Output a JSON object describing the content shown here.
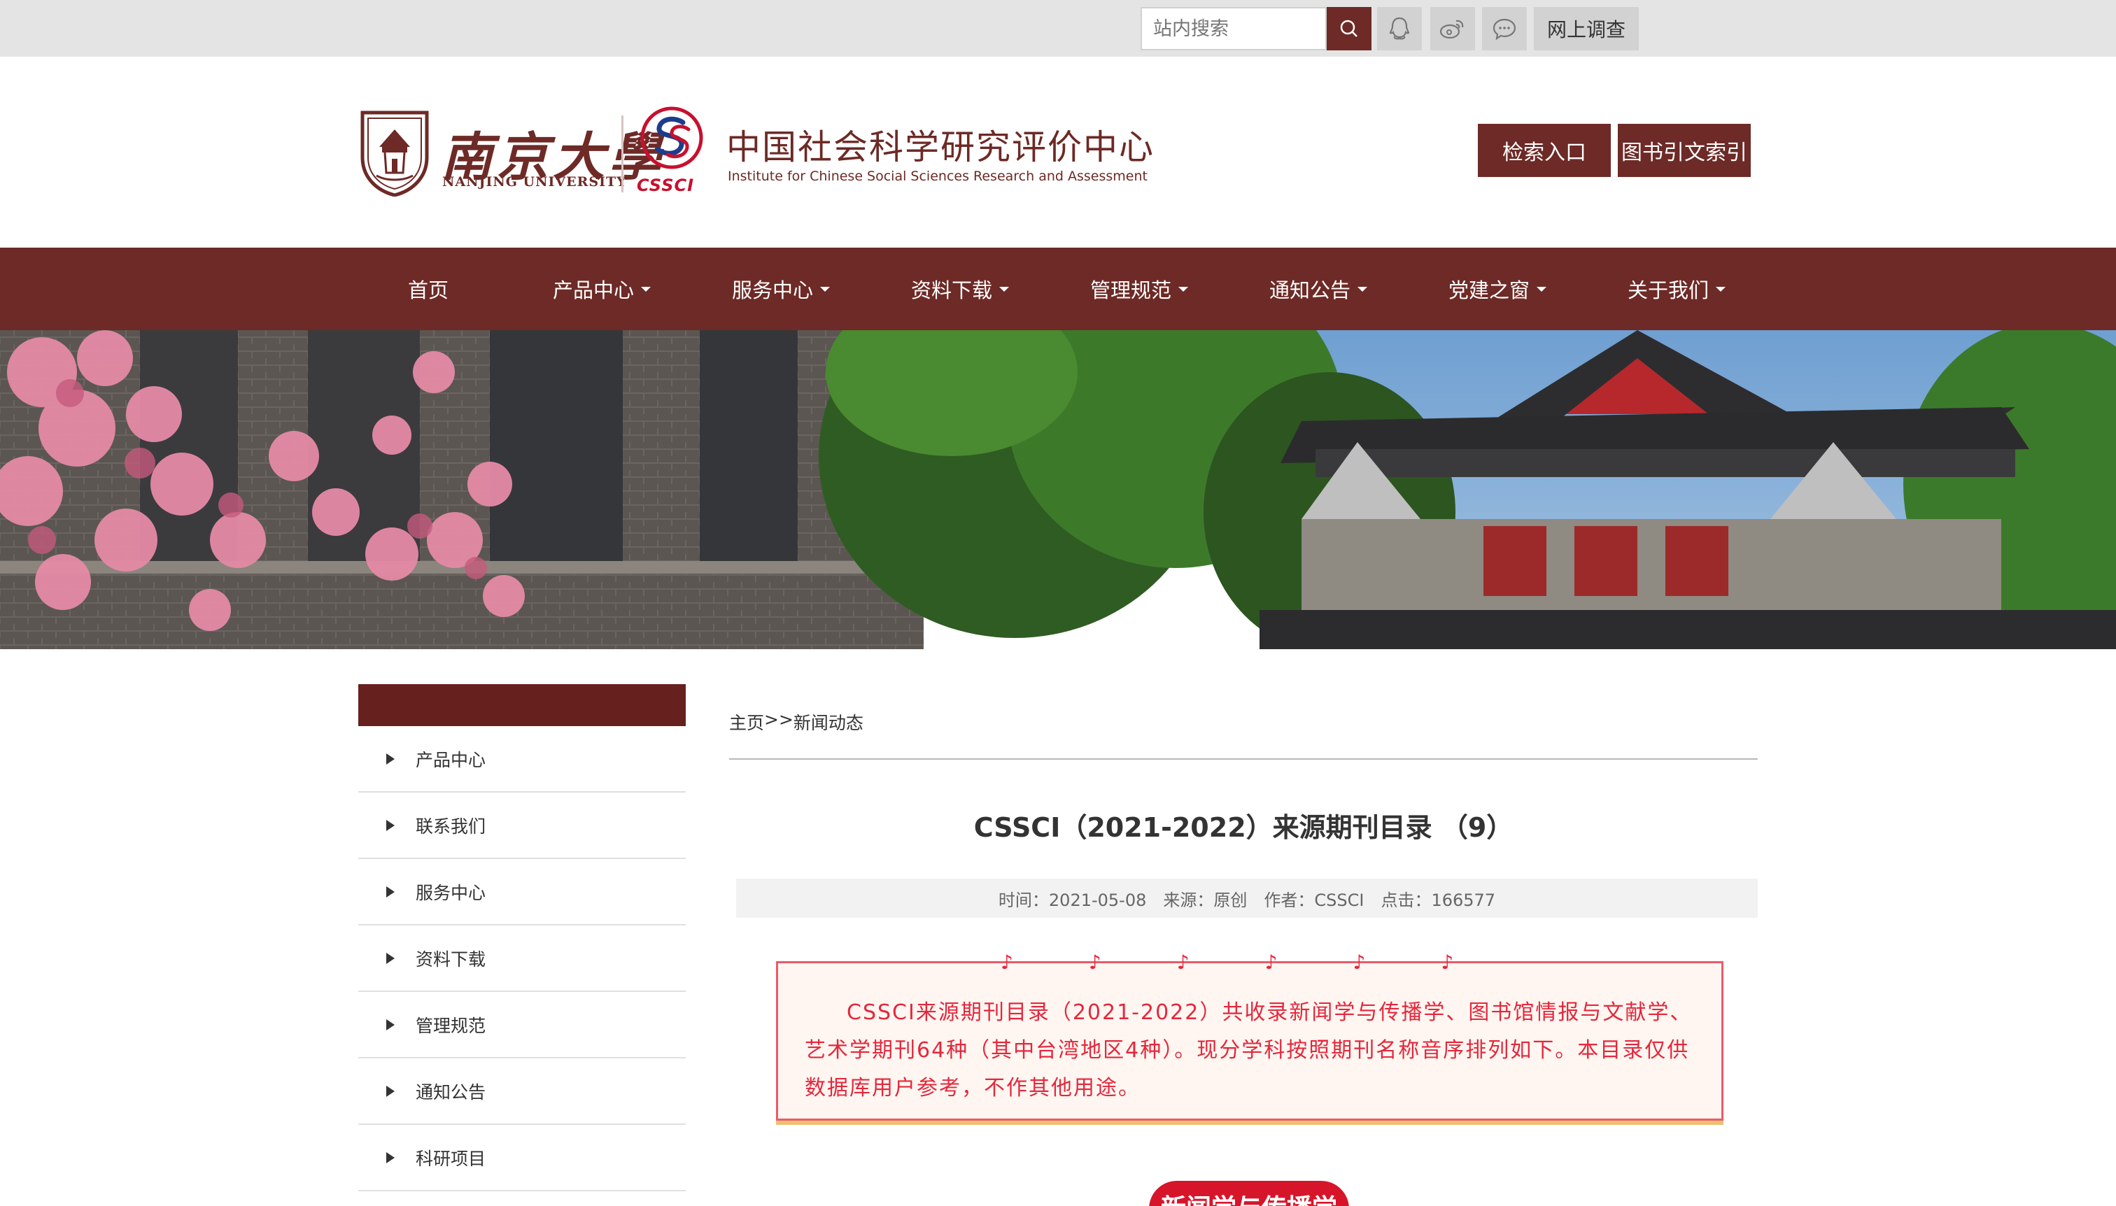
{
  "topbar": {
    "search_placeholder": "站内搜索",
    "search_icon": "search-icon",
    "social_icons": [
      "qq-icon",
      "weibo-icon",
      "wechat-icon"
    ],
    "survey_label": "网上调查"
  },
  "header": {
    "university_name_cn": "南京大學",
    "university_name_en": "NANJING UNIVERSITY",
    "cssci_logo_text": "CSSCI",
    "center_name_cn": "中国社会科学研究评价中心",
    "center_name_en": "Institute for Chinese Social Sciences Research and Assessment",
    "buttons": [
      "检索入口",
      "图书引文索引"
    ]
  },
  "nav": {
    "items": [
      {
        "label": "首页",
        "has_dropdown": false
      },
      {
        "label": "产品中心",
        "has_dropdown": true
      },
      {
        "label": "服务中心",
        "has_dropdown": true
      },
      {
        "label": "资料下载",
        "has_dropdown": true
      },
      {
        "label": "管理规范",
        "has_dropdown": true
      },
      {
        "label": "通知公告",
        "has_dropdown": true
      },
      {
        "label": "党建之窗",
        "has_dropdown": true
      },
      {
        "label": "关于我们",
        "has_dropdown": true
      }
    ]
  },
  "sidebar": {
    "items": [
      "产品中心",
      "联系我们",
      "服务中心",
      "资料下载",
      "管理规范",
      "通知公告",
      "科研项目"
    ]
  },
  "breadcrumb": {
    "home": "主页",
    "separator": " >>",
    "current": "新闻动态"
  },
  "article": {
    "title": "CSSCI（2021-2022）来源期刊目录 （9）",
    "meta": {
      "time": "时间：2021-05-08",
      "source": "来源：原创",
      "author": "作者：CSSCI",
      "clicks": "点击：166577"
    },
    "notice_text": "CSSCI来源期刊目录（2021-2022）共收录新闻学与传播学、图书馆情报与文献学、艺术学期刊64种（其中台湾地区4种）。现分学科按照期刊名称音序排列如下。本目录仅供数据库用户参考，不作其他用途。",
    "category_badge": "新闻学与传播学"
  },
  "colors": {
    "brand": "#6d2a26",
    "sidebar_header": "#66211e",
    "notice_red": "#e5273c",
    "badge_red": "#d7152a"
  }
}
